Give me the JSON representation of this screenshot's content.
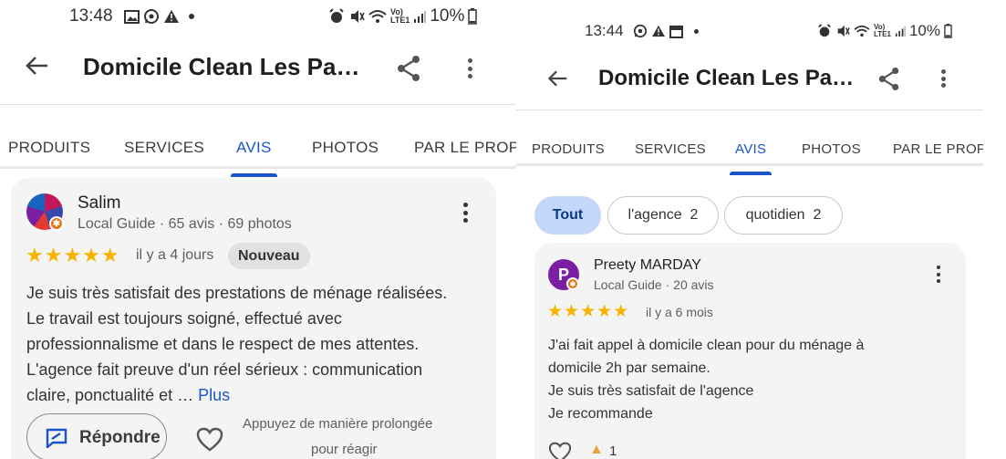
{
  "left": {
    "status": {
      "time": "13:48",
      "battery": "10%"
    },
    "appbar": {
      "title": "Domicile Clean Les Pa…"
    },
    "tabs": [
      "PRODUITS",
      "SERVICES",
      "AVIS",
      "PHOTOS",
      "PAR LE PROPR"
    ],
    "active_tab": "AVIS",
    "review": {
      "author": "Salim",
      "meta": "Local Guide · 65 avis · 69 photos",
      "rating": 5,
      "date": "il y a 4 jours",
      "new_badge": "Nouveau",
      "text": "Je suis très satisfait des prestations de ménage réalisées. Le travail est toujours soigné, effectué avec professionnalisme et dans le respect de mes attentes. L'agence fait preuve d'un réel sérieux : communication claire, ponctualité et …",
      "more_link": "Plus",
      "reply_button": "Répondre",
      "react_hint_line1": "Appuyez de manière prolongée",
      "react_hint_line2": "pour réagir"
    }
  },
  "right": {
    "status": {
      "time": "13:44",
      "battery": "10%"
    },
    "appbar": {
      "title": "Domicile Clean Les Pa…"
    },
    "tabs": [
      "PRODUITS",
      "SERVICES",
      "AVIS",
      "PHOTOS",
      "PAR LE PROPR"
    ],
    "active_tab": "AVIS",
    "filters": [
      {
        "label": "Tout",
        "count": ""
      },
      {
        "label": "l'agence",
        "count": "2"
      },
      {
        "label": "quotidien",
        "count": "2"
      }
    ],
    "review": {
      "avatar_letter": "P",
      "author": "Preety MARDAY",
      "meta": "Local Guide · 20 avis",
      "rating": 5,
      "date": "il y a 6 mois",
      "lines": [
        "J'ai fait appel à domicile clean pour du ménage à",
        "domicile 2h par semaine.",
        "Je suis très satisfait de l'agence",
        "Je recommande"
      ],
      "like_count": "1"
    }
  },
  "colors": {
    "accent": "#1a56c9",
    "star": "#f4b400",
    "guide_badge": "#e8710a",
    "card_bg": "#f4f4f4",
    "chip_active": "#c2d7fa"
  }
}
